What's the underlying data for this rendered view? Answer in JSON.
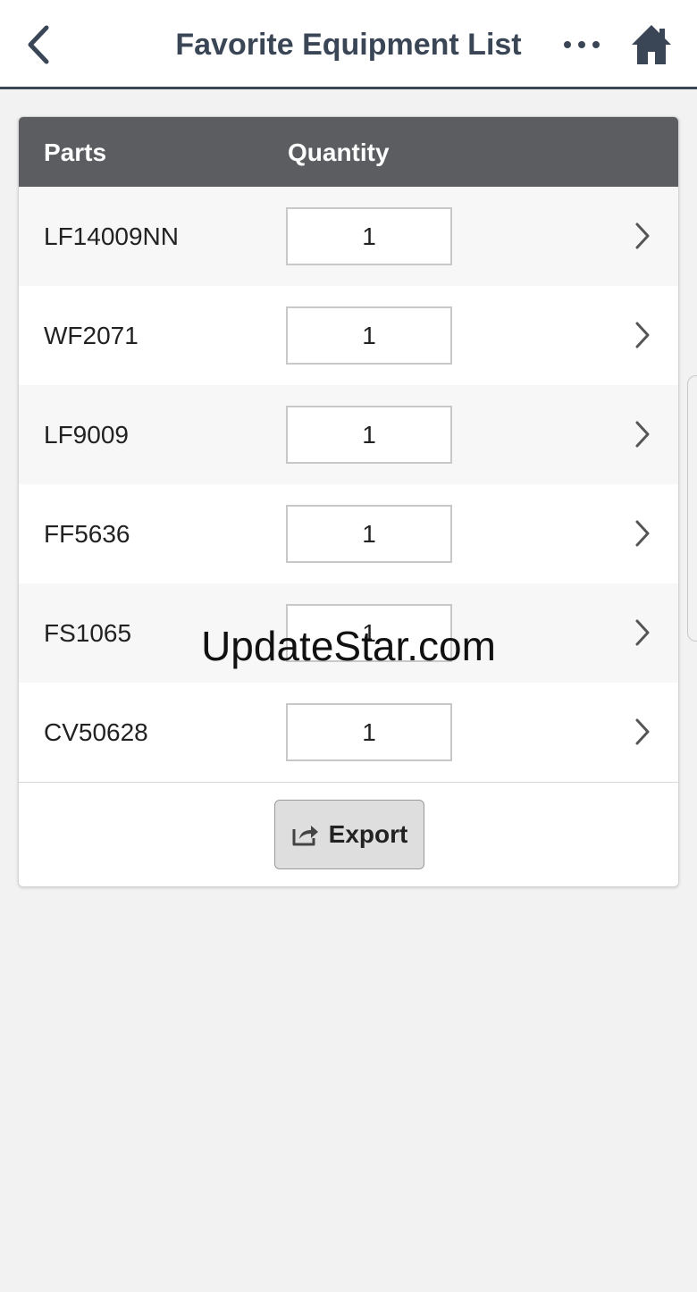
{
  "header": {
    "title": "Favorite Equipment List",
    "back_icon": "chevron-left-icon",
    "more_icon": "more-horizontal-icon",
    "home_icon": "home-icon",
    "accent_color": "#3a4656"
  },
  "table": {
    "columns": {
      "parts": "Parts",
      "quantity": "Quantity"
    },
    "header_color": "#5b5d60",
    "rows": [
      {
        "part": "LF14009NN",
        "quantity": "1"
      },
      {
        "part": "WF2071",
        "quantity": "1"
      },
      {
        "part": "LF9009",
        "quantity": "1"
      },
      {
        "part": "FF5636",
        "quantity": "1"
      },
      {
        "part": "FS1065",
        "quantity": "1"
      },
      {
        "part": "CV50628",
        "quantity": "1"
      }
    ]
  },
  "footer": {
    "export_label": "Export",
    "export_icon": "share-export-icon"
  },
  "watermark": "UpdateStar.com"
}
